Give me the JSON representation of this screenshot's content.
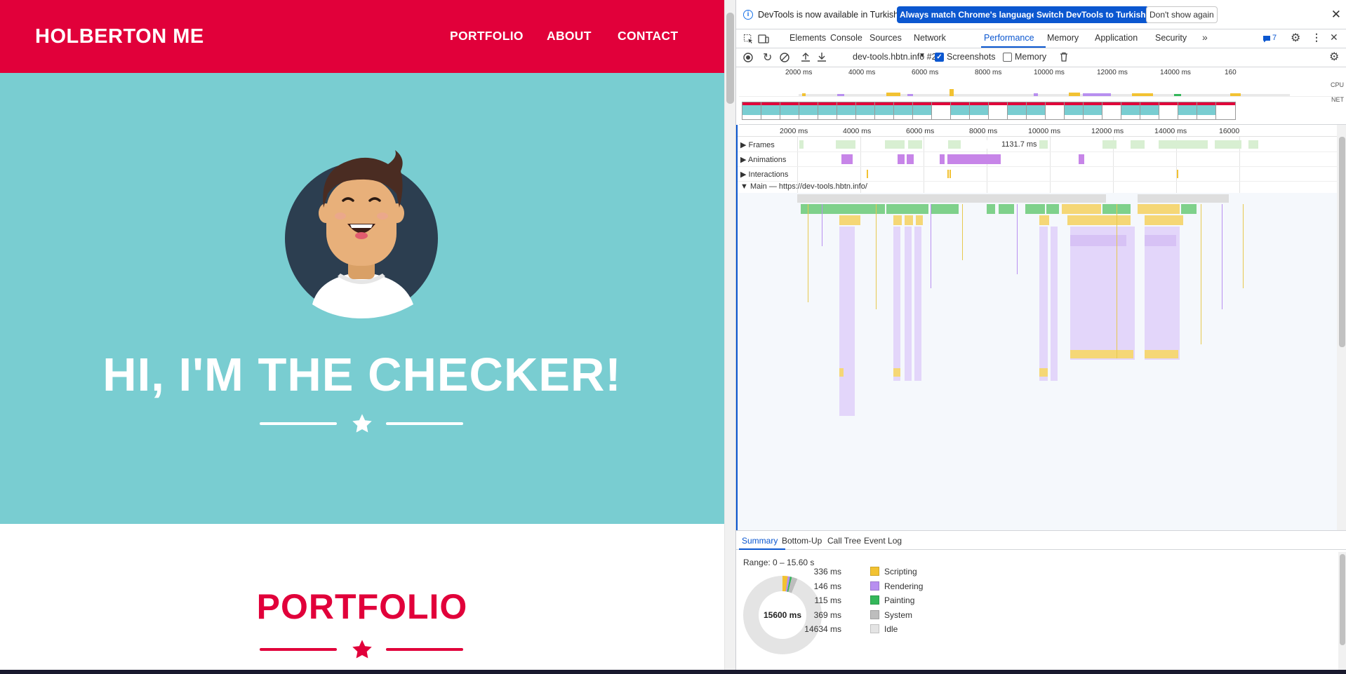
{
  "site": {
    "brand": "HOLBERTON ME",
    "nav": [
      "PORTFOLIO",
      "ABOUT",
      "CONTACT"
    ],
    "hero_title": "HI, I'M THE CHECKER!",
    "section_title": "PORTFOLIO",
    "colors": {
      "primary": "#e1003a",
      "hero_bg": "#79cdd1",
      "white": "#ffffff"
    }
  },
  "devtools": {
    "info": {
      "message": "DevTools is now available in Turkish!",
      "btn_match": "Always match Chrome's language",
      "btn_switch": "Switch DevTools to Turkish",
      "btn_dismiss": "Don't show again"
    },
    "tabs": [
      "Elements",
      "Console",
      "Sources",
      "Network",
      "Performance",
      "Memory",
      "Application",
      "Security"
    ],
    "active_tab": "Performance",
    "issues_count": "7",
    "toolbar": {
      "recording": "dev-tools.hbtn.info #2",
      "screenshots_label": "Screenshots",
      "memory_label": "Memory",
      "screenshots_checked": true,
      "memory_checked": false
    },
    "overview": {
      "ticks": [
        "2000 ms",
        "4000 ms",
        "6000 ms",
        "8000 ms",
        "10000 ms",
        "12000 ms",
        "14000 ms",
        "160"
      ],
      "cpu_label": "CPU",
      "net_label": "NET"
    },
    "timeline": {
      "ticks": [
        "2000 ms",
        "4000 ms",
        "6000 ms",
        "8000 ms",
        "10000 ms",
        "12000 ms",
        "14000 ms",
        "16000"
      ],
      "tracks": [
        "Frames",
        "Animations",
        "Interactions",
        "Main — https://dev-tools.hbtn.info/"
      ],
      "frame_label": "1131.7 ms"
    },
    "bottom": {
      "tabs": [
        "Summary",
        "Bottom-Up",
        "Call Tree",
        "Event Log"
      ],
      "active_tab": "Summary",
      "range": "Range: 0 – 15.60 s",
      "total": "15600 ms",
      "legend": [
        {
          "ms": "336 ms",
          "name": "Scripting",
          "color": "#f2c232",
          "value": 336
        },
        {
          "ms": "146 ms",
          "name": "Rendering",
          "color": "#b88ff0",
          "value": 146
        },
        {
          "ms": "115 ms",
          "name": "Painting",
          "color": "#34b75a",
          "value": 115
        },
        {
          "ms": "369 ms",
          "name": "System",
          "color": "#bdbdbd",
          "value": 369
        },
        {
          "ms": "14634 ms",
          "name": "Idle",
          "color": "#e4e4e4",
          "value": 14634
        }
      ]
    }
  }
}
